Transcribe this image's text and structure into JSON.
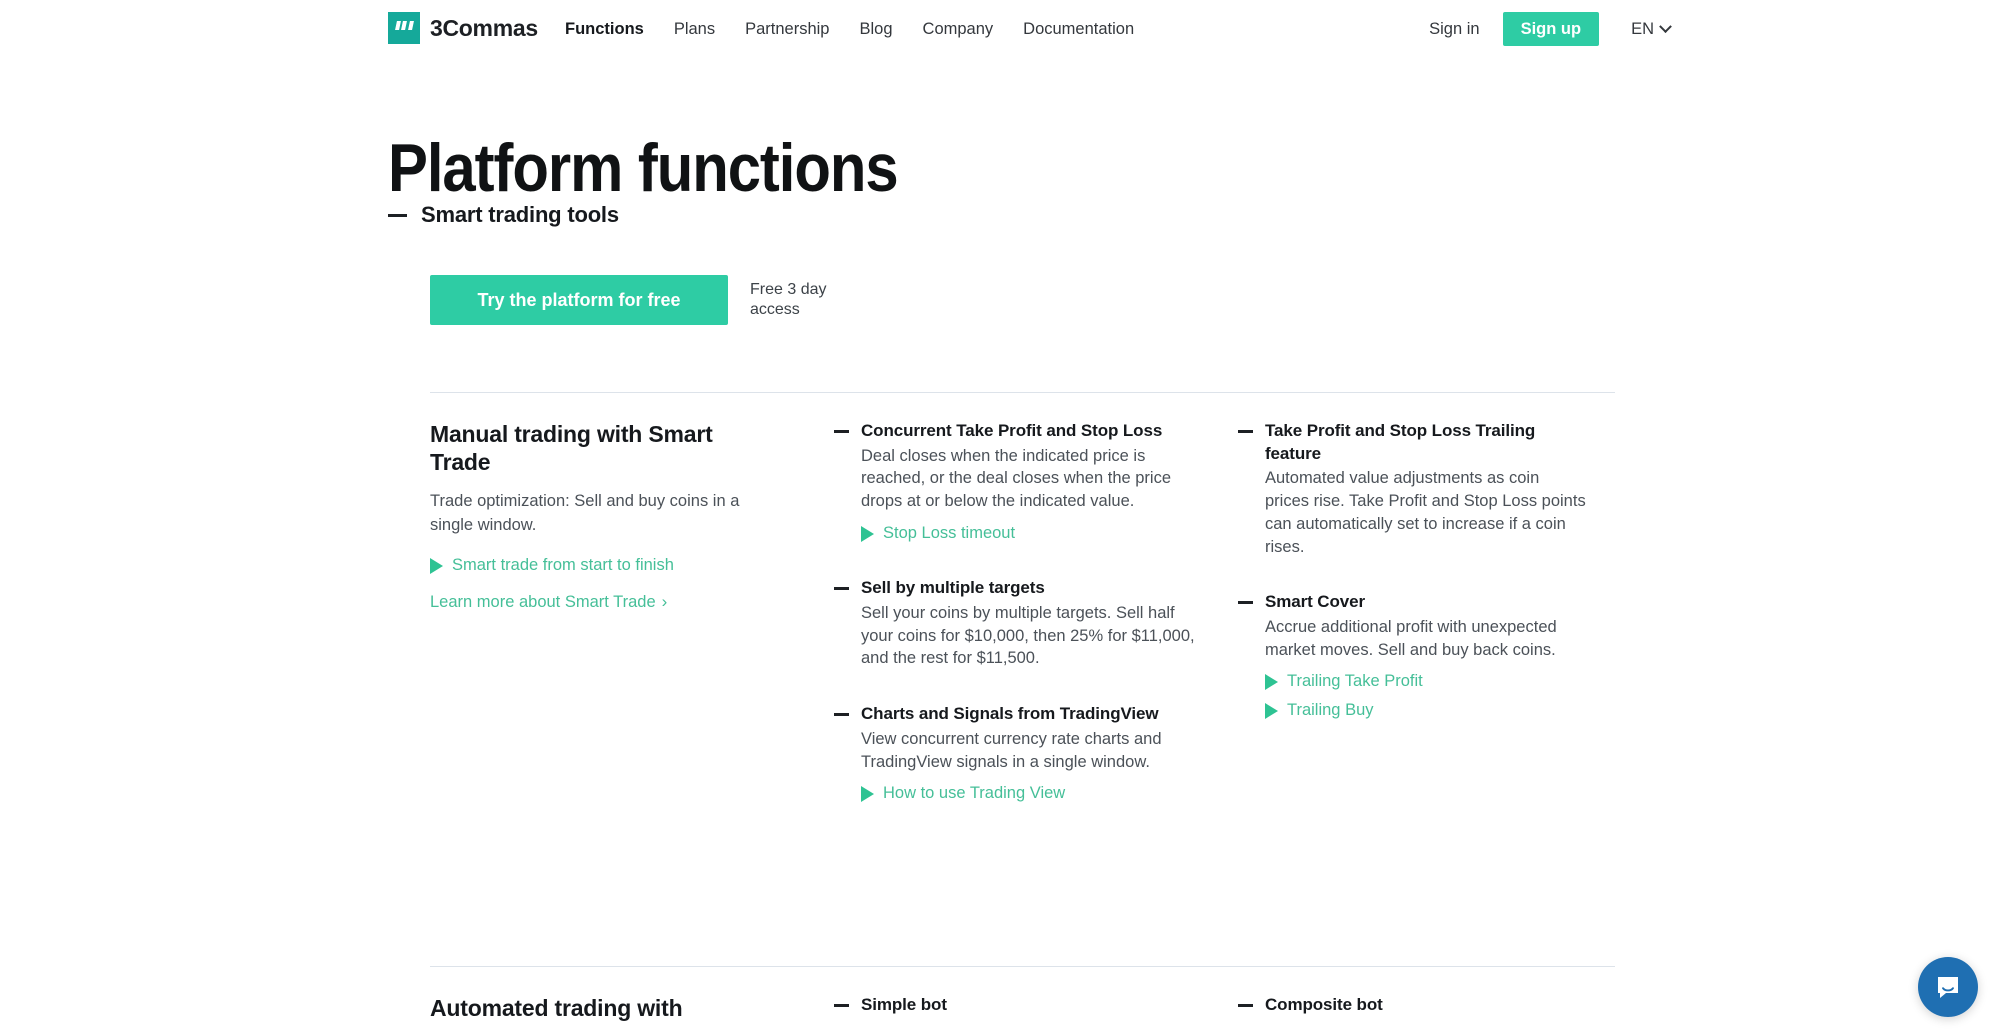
{
  "header": {
    "brand": {
      "name": "3Commas",
      "mark_icon": "three-commas-logo-icon"
    },
    "nav": [
      {
        "label": "Functions",
        "active": true
      },
      {
        "label": "Plans",
        "active": false
      },
      {
        "label": "Partnership",
        "active": false
      },
      {
        "label": "Blog",
        "active": false
      },
      {
        "label": "Company",
        "active": false
      },
      {
        "label": "Documentation",
        "active": false
      }
    ],
    "sign_in_label": "Sign in",
    "sign_up_label": "Sign up",
    "language": "EN",
    "language_chevron_icon": "chevron-down-icon"
  },
  "hero": {
    "title": "Platform functions",
    "subtitle": "Smart trading tools",
    "cta_label": "Try the platform for free",
    "cta_note": "Free 3 day access"
  },
  "sections": [
    {
      "intro": {
        "title": "Manual trading with Smart Trade",
        "description": "Trade optimization: Sell and buy coins in a single window.",
        "video_links": [
          {
            "label": "Smart trade from start to finish",
            "icon": "play-icon"
          }
        ],
        "more_link": {
          "label": "Learn more about Smart Trade",
          "icon": "chevron-right-icon"
        }
      },
      "col2": [
        {
          "title": "Concurrent Take Profit and Stop Loss",
          "body": "Deal closes when the indicated price is reached, or the deal closes when the price drops at or below the indicated value.",
          "links": [
            {
              "label": "Stop Loss timeout",
              "icon": "play-icon"
            }
          ]
        },
        {
          "title": "Sell by multiple targets",
          "body": "Sell your coins by multiple targets. Sell half your coins for $10,000, then 25% for $11,000, and the rest for $11,500.",
          "links": []
        },
        {
          "title": "Charts and Signals from TradingView",
          "body": "View concurrent currency rate charts and TradingView signals in a single window.",
          "links": [
            {
              "label": "How to use Trading View",
              "icon": "play-icon"
            }
          ]
        }
      ],
      "col3": [
        {
          "title": "Take Profit and Stop Loss Trailing feature",
          "body": "Automated value adjustments as coin prices rise. Take Profit and Stop Loss points can automatically set to increase if a coin rises.",
          "links": []
        },
        {
          "title": "Smart Cover",
          "body": "Accrue additional profit with unexpected market moves. Sell and buy back coins.",
          "links": [
            {
              "label": "Trailing Take Profit",
              "icon": "play-icon"
            },
            {
              "label": "Trailing Buy",
              "icon": "play-icon"
            }
          ]
        }
      ]
    },
    {
      "intro": {
        "title": "Automated trading with"
      },
      "col2": [
        {
          "title": "Simple bot"
        }
      ],
      "col3": [
        {
          "title": "Composite bot"
        }
      ]
    }
  ],
  "chat_widget": {
    "icon": "chat-bubble-icon"
  }
}
